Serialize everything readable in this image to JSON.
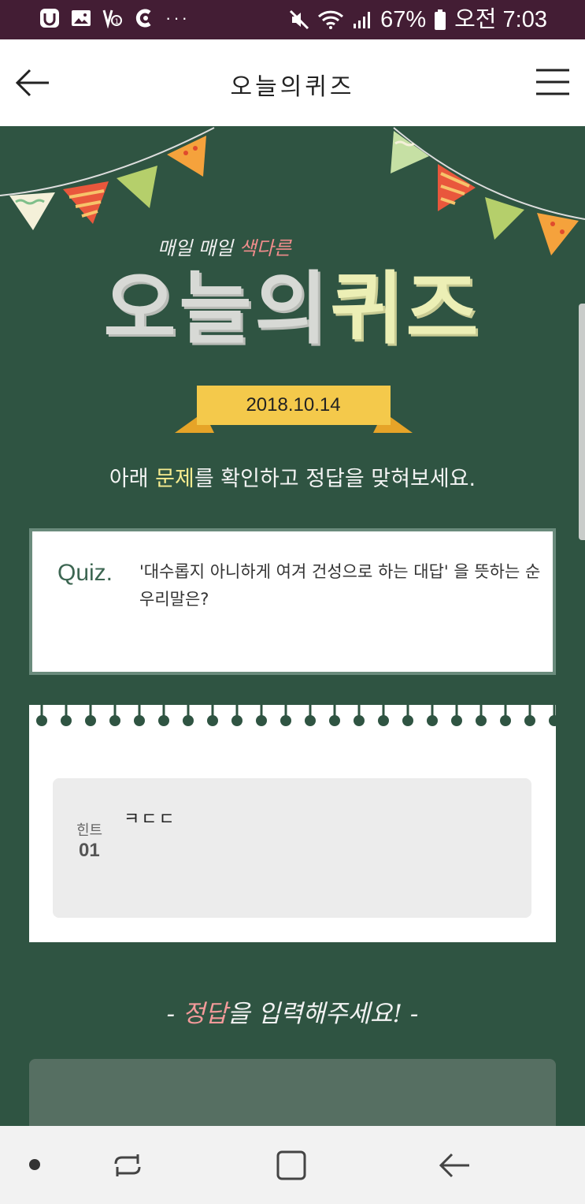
{
  "status_bar": {
    "battery_percent": "67%",
    "time": "오전 7:03",
    "more": "···",
    "icons": [
      "app-u-icon",
      "image-icon",
      "voice-icon",
      "mic-icon",
      "mute-icon",
      "wifi-icon",
      "signal-icon",
      "battery-icon"
    ]
  },
  "header": {
    "title": "오늘의퀴즈",
    "back_icon": "arrow-left-icon",
    "menu_icon": "hamburger-icon"
  },
  "hero": {
    "tagline_normal": "매일 매일 ",
    "tagline_highlight": "색다른",
    "title_part1": "오늘의",
    "title_part2": "퀴즈",
    "date": "2018.10.14"
  },
  "instruction": {
    "prefix": "아래 ",
    "highlight": "문제",
    "suffix": "를 확인하고 정답을 맞혀보세요."
  },
  "quiz": {
    "label": "Quiz.",
    "question": "'대수롭지 아니하게 여겨 건성으로 하는 대답' 을 뜻하는 순우리말은?"
  },
  "hint": {
    "label": "힌트",
    "number": "01",
    "text": "ㅋㄷㄷ"
  },
  "answer": {
    "prefix": "- ",
    "highlight": "정답",
    "suffix": "을 입력해주세요! -"
  },
  "colors": {
    "status_bar": "#431d34",
    "board_green": "#2f5442",
    "ribbon_yellow": "#f4c94b",
    "highlight_yellow": "#f6ec8f",
    "pink": "#f18c8c"
  },
  "nav_bar": {
    "icons": [
      "dot-icon",
      "recents-icon",
      "home-icon",
      "back-icon"
    ]
  }
}
